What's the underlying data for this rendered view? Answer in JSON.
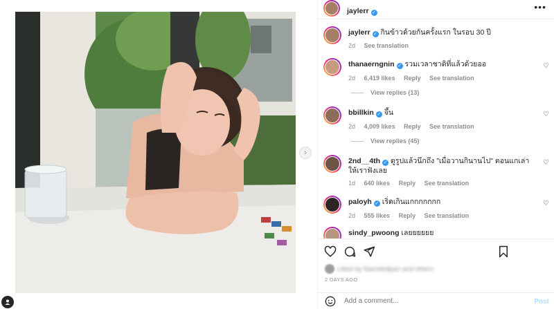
{
  "post": {
    "author": "jaylerr",
    "caption": "กินข้าวด้วยกันครั้งแรก ในรอบ 30 ปี",
    "caption_age": "2d",
    "see_translation": "See translation",
    "liked_by_blurred": "Liked by Namekdipan and others",
    "timestamp": "2 DAYS AGO"
  },
  "header": {
    "more_icon": "•••"
  },
  "comments": [
    {
      "user": "thanaerngnin",
      "text": "รวมเวลาชาติที่แล้วด้วยออ",
      "age": "2d",
      "likes": "6,419 likes",
      "reply": "Reply",
      "translate": "See translation",
      "replies": "View replies (13)"
    },
    {
      "user": "bbillkin",
      "text": "จึ้น",
      "age": "2d",
      "likes": "4,009 likes",
      "reply": "Reply",
      "translate": "See translation",
      "replies": "View replies (45)"
    },
    {
      "user": "2nd__4th",
      "text": "ดูรูปแล้วนึกถึง \"เมื่อวานกินานไป\" ตอนแกเล่าให้เราฟังเลย",
      "age": "1d",
      "likes": "640 likes",
      "reply": "Reply",
      "translate": "See translation"
    },
    {
      "user": "paloyh",
      "text": "เริ่ดเกินแกกกกกกก",
      "age": "2d",
      "likes": "555 likes",
      "reply": "Reply",
      "translate": "See translation"
    },
    {
      "user": "sindy_pwoong",
      "text": "เลยยยยยย"
    }
  ],
  "add_comment": {
    "placeholder": "Add a comment...",
    "post_label": "Post"
  },
  "icons": {
    "like": "heart-icon",
    "comment": "comment-icon",
    "share": "share-icon",
    "save": "bookmark-icon",
    "emoji": "smiley-icon",
    "next": "chevron-right-icon"
  },
  "colors": {
    "verified": "#3897f0",
    "story_ring_start": "#f9ce34",
    "story_ring_end": "#6228d7",
    "post_button": "#b3dbff"
  }
}
